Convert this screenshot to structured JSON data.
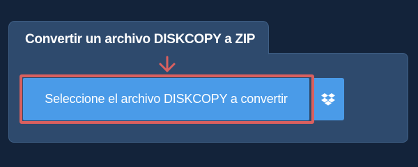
{
  "panel": {
    "title": "Convertir un archivo DISKCOPY a ZIP"
  },
  "select_button": {
    "label": "Seleccione el archivo DISKCOPY a convertir"
  },
  "icons": {
    "arrow": "arrow-down-icon",
    "dropbox": "dropbox-icon"
  },
  "colors": {
    "page_background": "#13233a",
    "panel_background": "#2e4a6d",
    "button": "#4a9be8",
    "highlight": "#d9605f"
  }
}
